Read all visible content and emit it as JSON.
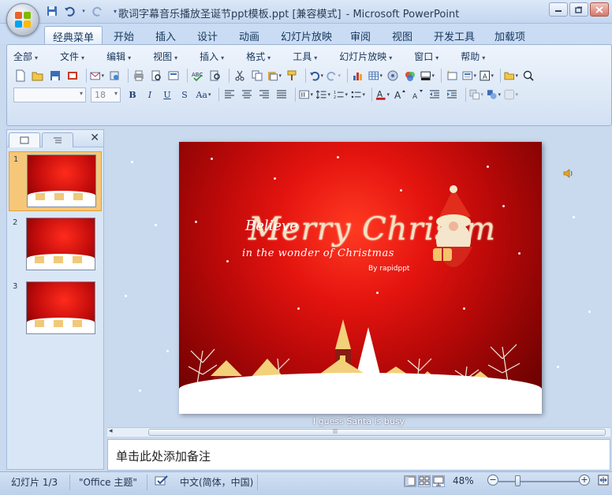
{
  "window": {
    "title": "歌词字幕音乐播放圣诞节ppt模板.ppt [兼容模式]",
    "app": "- Microsoft PowerPoint"
  },
  "tabs": [
    "经典菜单",
    "开始",
    "插入",
    "设计",
    "动画",
    "幻灯片放映",
    "审阅",
    "视图",
    "开发工具",
    "加载项"
  ],
  "menubar": [
    "全部",
    "文件",
    "编辑",
    "视图",
    "插入",
    "格式",
    "工具",
    "幻灯片放映",
    "窗口",
    "帮助"
  ],
  "format_bar": {
    "font_name": "",
    "font_size": "18",
    "bold": "B",
    "italic": "I",
    "underline": "U",
    "strike": "S",
    "font_case": "Aa"
  },
  "thumbnails": [
    {
      "number": "1"
    },
    {
      "number": "2"
    },
    {
      "number": "3"
    }
  ],
  "slide": {
    "title_main": "Merry Christm",
    "title_believe": "Believe",
    "subtitle": "in the wonder of Christmas",
    "byline": "By  rapidppt",
    "caption": "I guess Santa is busy"
  },
  "notes_placeholder": "单击此处添加备注",
  "status": {
    "slide_counter": "幻灯片 1/3",
    "theme": "\"Office 主题\"",
    "language": "中文(简体，中国)",
    "zoom": "48%",
    "zoom_level": 0.48
  },
  "colors": {
    "accent": "#2b579a",
    "selection": "#f6c779",
    "slide_red": "#e4140f"
  }
}
